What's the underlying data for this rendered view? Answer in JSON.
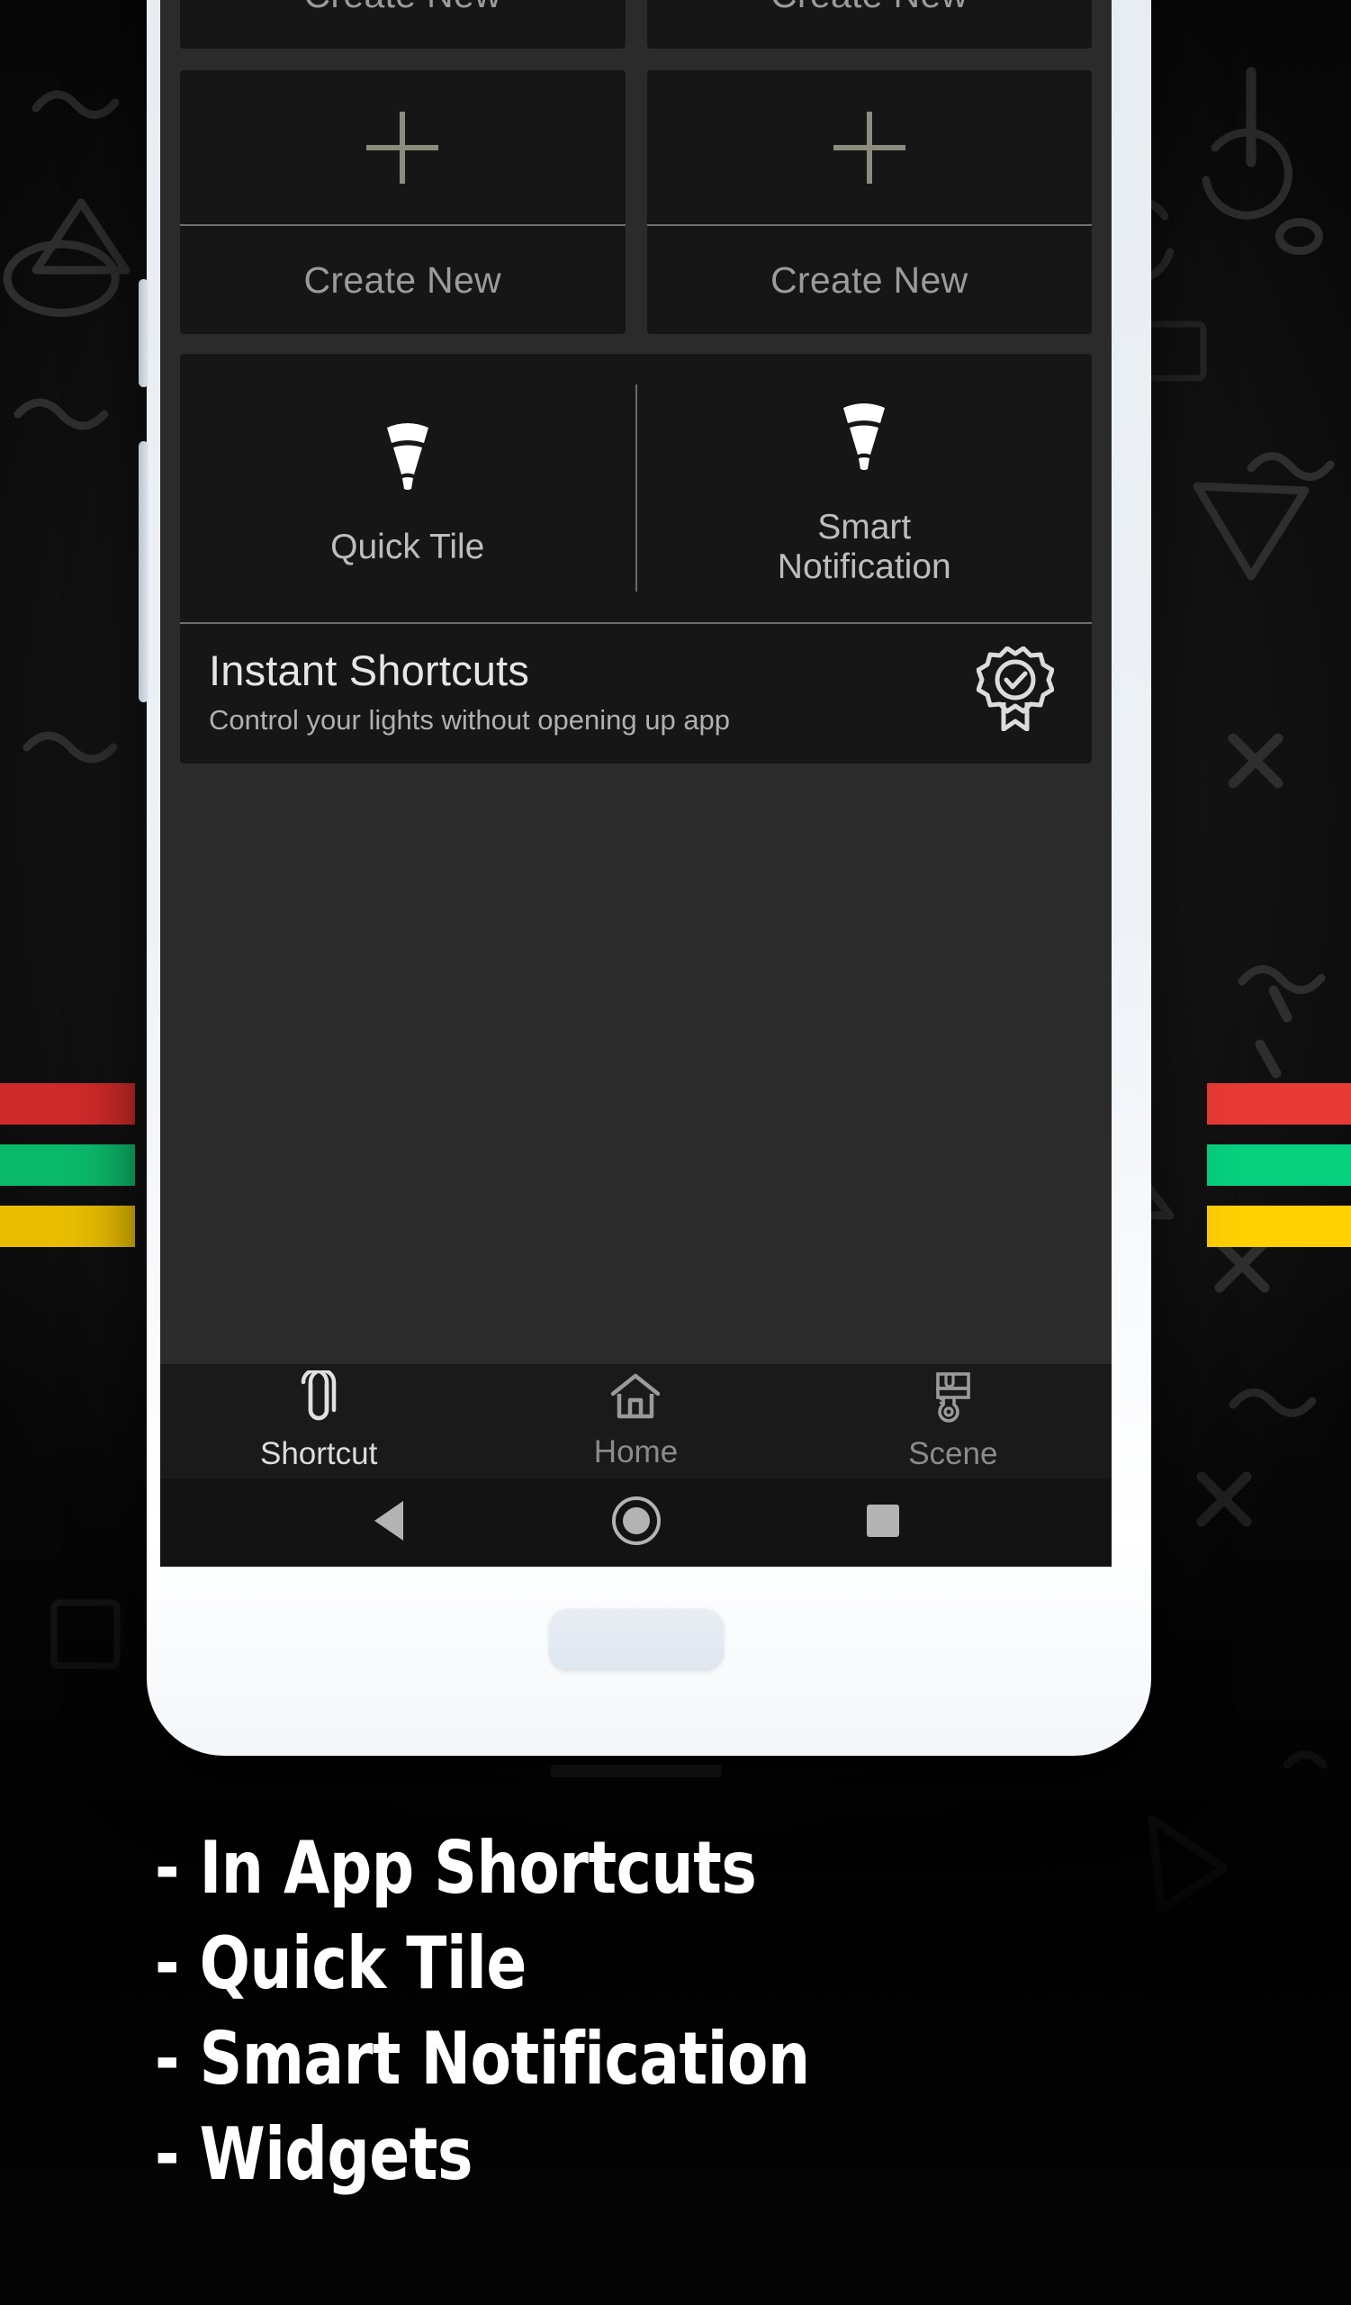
{
  "background": {
    "base_color": "#0b0b0b",
    "doodle_color": "#2b2b2b"
  },
  "stripes": {
    "left": [
      {
        "name": "red-stripe",
        "color": "#cf2a2a"
      },
      {
        "name": "green-stripe",
        "color": "#0bb96b"
      },
      {
        "name": "yellow-stripe",
        "color": "#e8bd00"
      }
    ],
    "right": [
      {
        "name": "red-stripe",
        "color": "#ea3a35"
      },
      {
        "name": "green-stripe",
        "color": "#07d07f"
      },
      {
        "name": "yellow-stripe",
        "color": "#ffd100"
      }
    ]
  },
  "phone": {
    "body_color": "#eef2f7",
    "screen_bg": "#2b2b2b",
    "card_bg": "#161616"
  },
  "app": {
    "shortcut_grid": {
      "row_top": [
        {
          "label": "Create New",
          "icon": "plus-icon"
        },
        {
          "label": "Create New",
          "icon": "plus-icon"
        }
      ],
      "row_bottom": [
        {
          "label": "Create New",
          "icon": "plus-icon"
        },
        {
          "label": "Create New",
          "icon": "plus-icon"
        }
      ]
    },
    "instant_card": {
      "quick_tile": {
        "label": "Quick Tile",
        "icon": "light-bulb-icon"
      },
      "smart_notification": {
        "label": "Smart\nNotification",
        "label_line1": "Smart",
        "label_line2": "Notification",
        "icon": "light-bulb-icon"
      },
      "title": "Instant Shortcuts",
      "subtitle": "Control your lights without opening up app",
      "badge_icon": "verified-badge-icon"
    },
    "tabbar": [
      {
        "label": "Shortcut",
        "icon": "paperclip-icon",
        "active": true
      },
      {
        "label": "Home",
        "icon": "home-icon",
        "active": false
      },
      {
        "label": "Scene",
        "icon": "paint-brush-icon",
        "active": false
      }
    ],
    "navbar": [
      {
        "name": "back-button",
        "icon": "triangle-back-icon"
      },
      {
        "name": "home-button",
        "icon": "circle-home-icon"
      },
      {
        "name": "recents-button",
        "icon": "square-recents-icon"
      }
    ]
  },
  "caption": {
    "lines": [
      "- In App Shortcuts",
      "- Quick Tile",
      "- Smart Notification",
      "- Widgets"
    ]
  }
}
